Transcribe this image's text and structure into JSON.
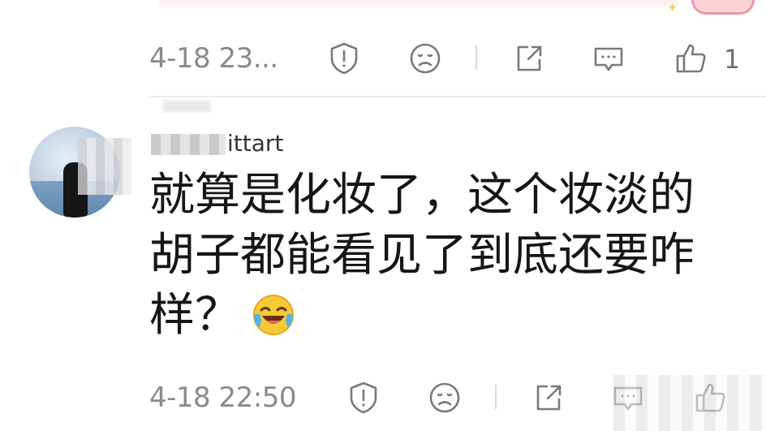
{
  "previous_comment": {
    "timestamp": "4-18 23...",
    "like_count": "1",
    "actions": {
      "report_icon": "report-icon",
      "dislike_icon": "dislike-icon",
      "share_icon": "share-icon",
      "reply_icon": "reply-icon",
      "like_icon": "thumbs-up-icon"
    }
  },
  "comment": {
    "username": "ittart",
    "text_lines": [
      "就算是化妆了，这个妆淡的",
      "胡子都能看见了到底还要咋",
      "样？"
    ],
    "emoji": "laugh-cry-emoji",
    "timestamp": "4-18 22:50"
  },
  "colors": {
    "timestamp": "#8a8a8a",
    "icon_stroke": "#7a7a7a",
    "text": "#161616"
  }
}
